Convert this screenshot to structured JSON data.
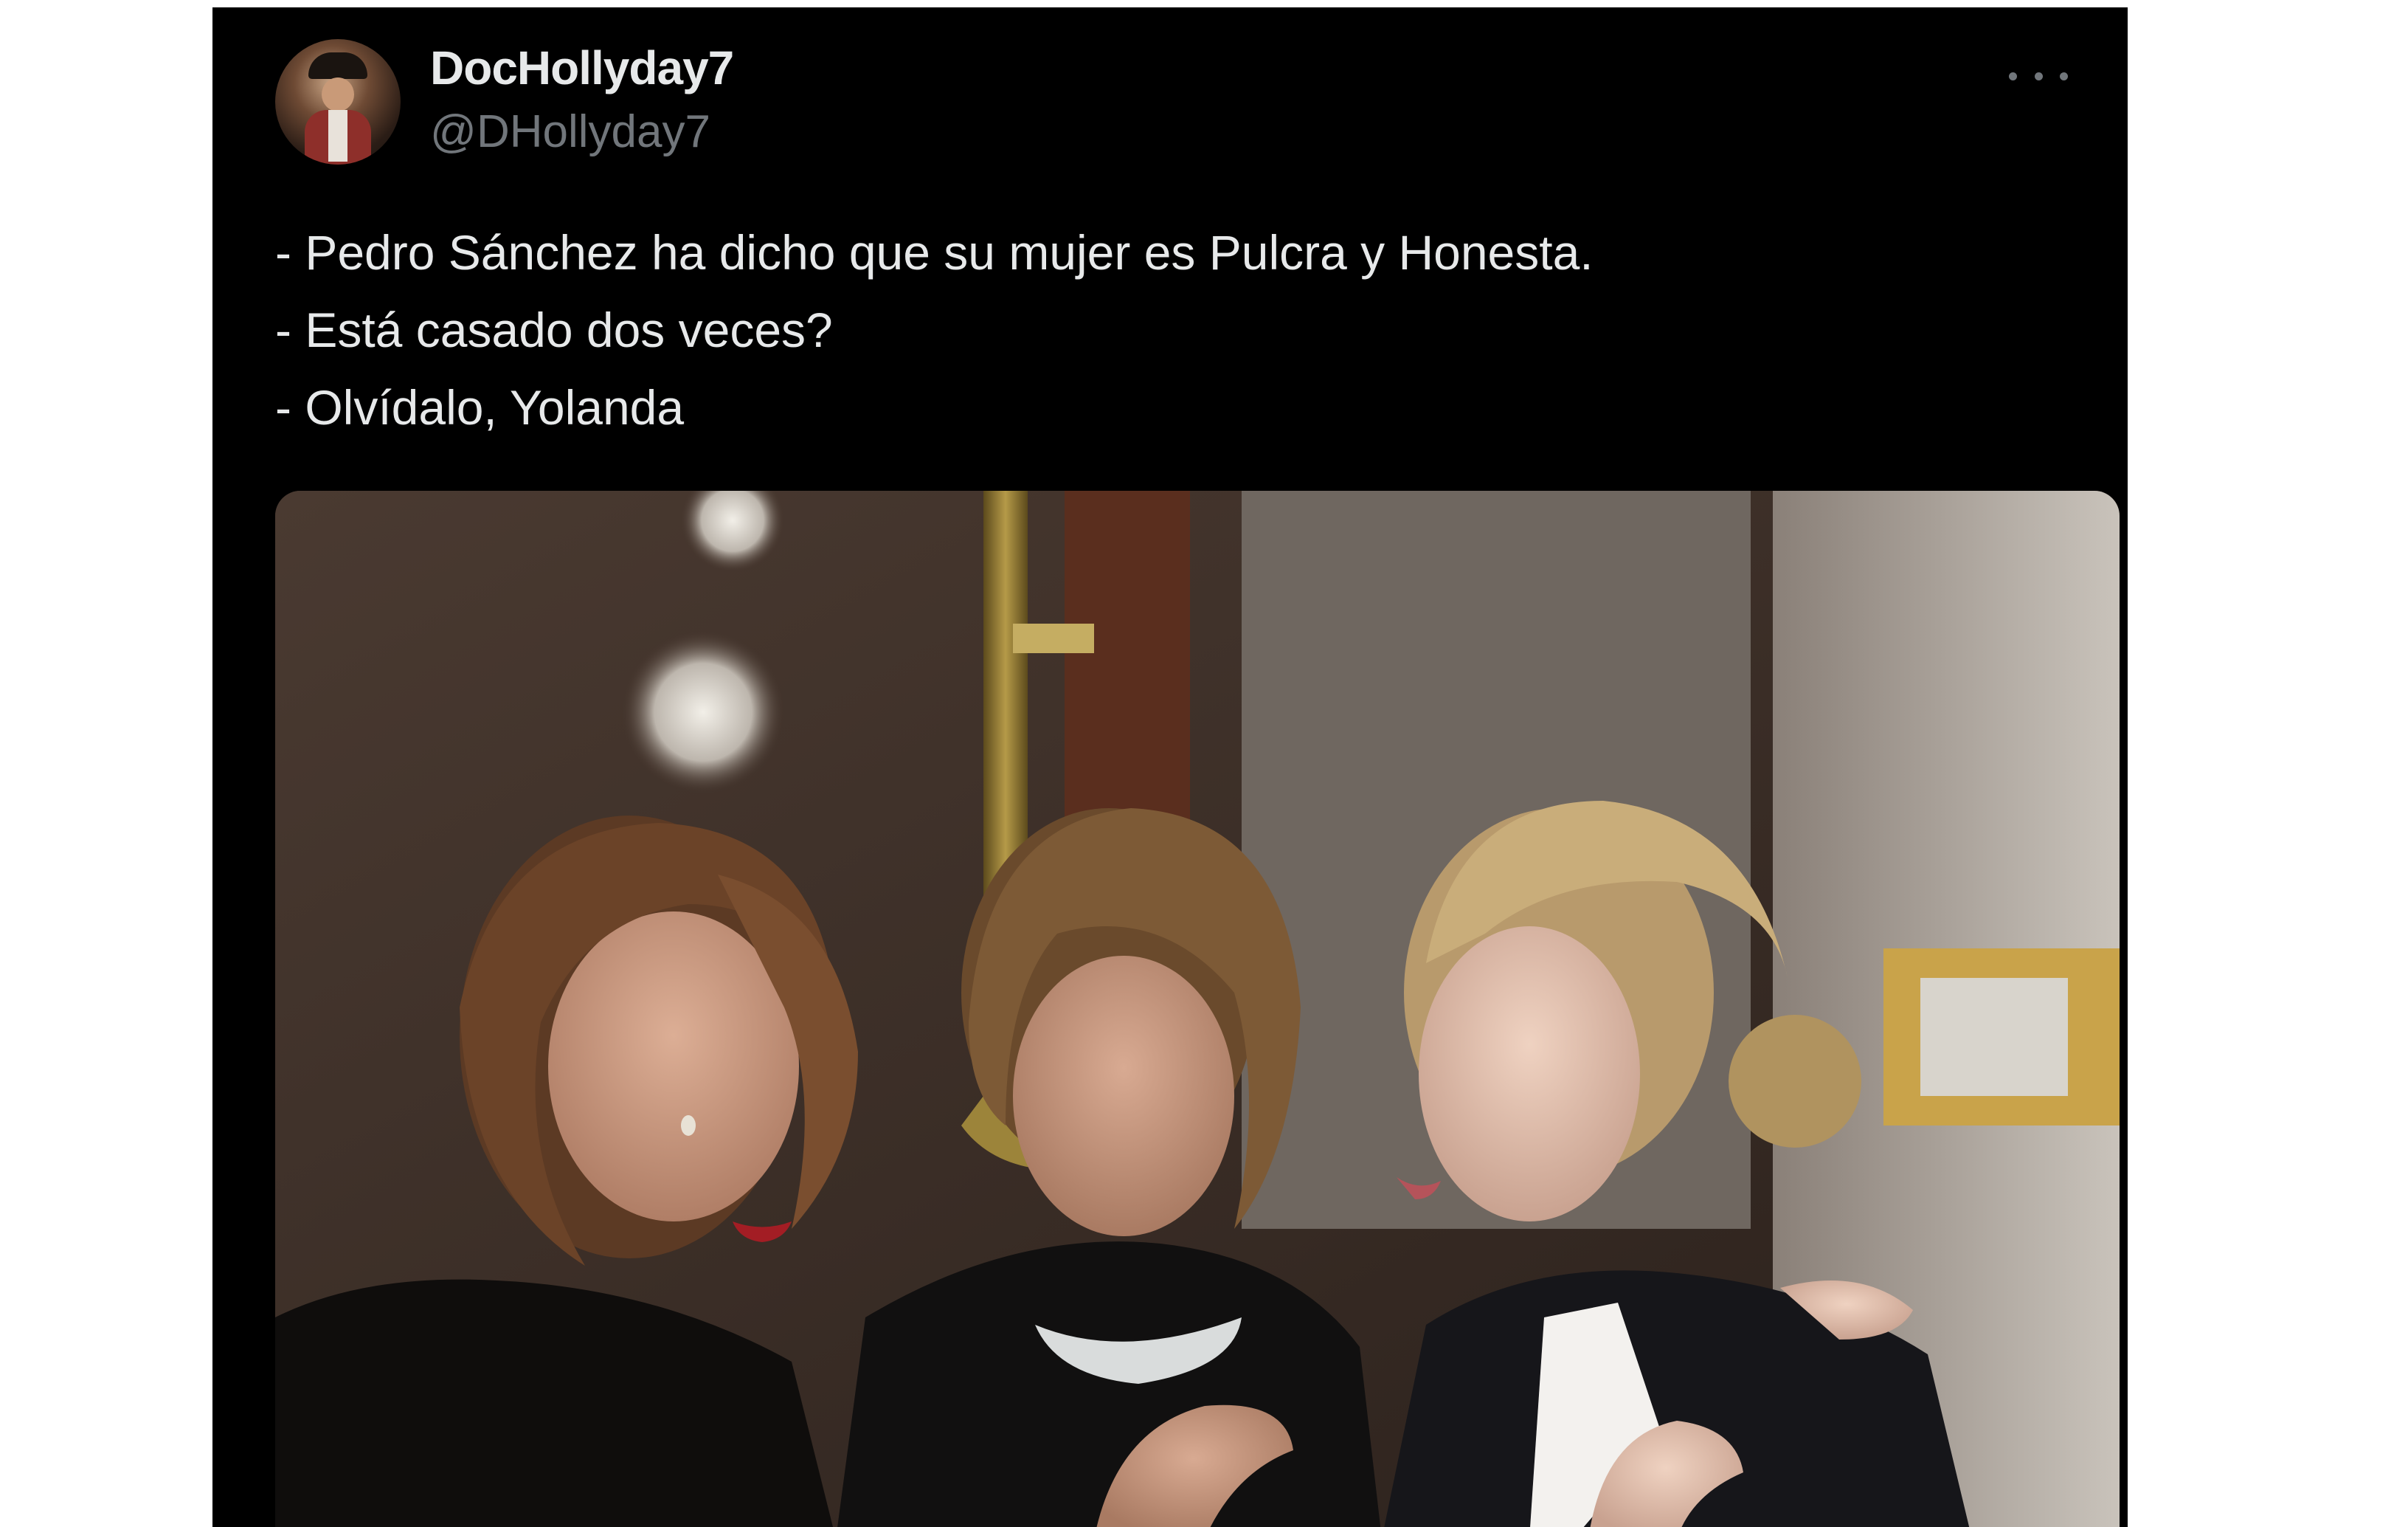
{
  "tweet": {
    "author": {
      "display_name": "DocHollyday7",
      "handle": "@DHollyday7",
      "avatar_icon": "user-avatar"
    },
    "more_icon": "more-horizontal-icon",
    "text_lines": [
      "- Pedro Sánchez ha dicho que su mujer es Pulcra y Honesta.",
      "- Está casado dos veces?",
      "- Olvídalo, Yolanda"
    ],
    "media": {
      "type": "photo"
    }
  },
  "colors": {
    "background": "#000000",
    "text_primary": "#e7e9ea",
    "text_secondary": "#71767b"
  }
}
